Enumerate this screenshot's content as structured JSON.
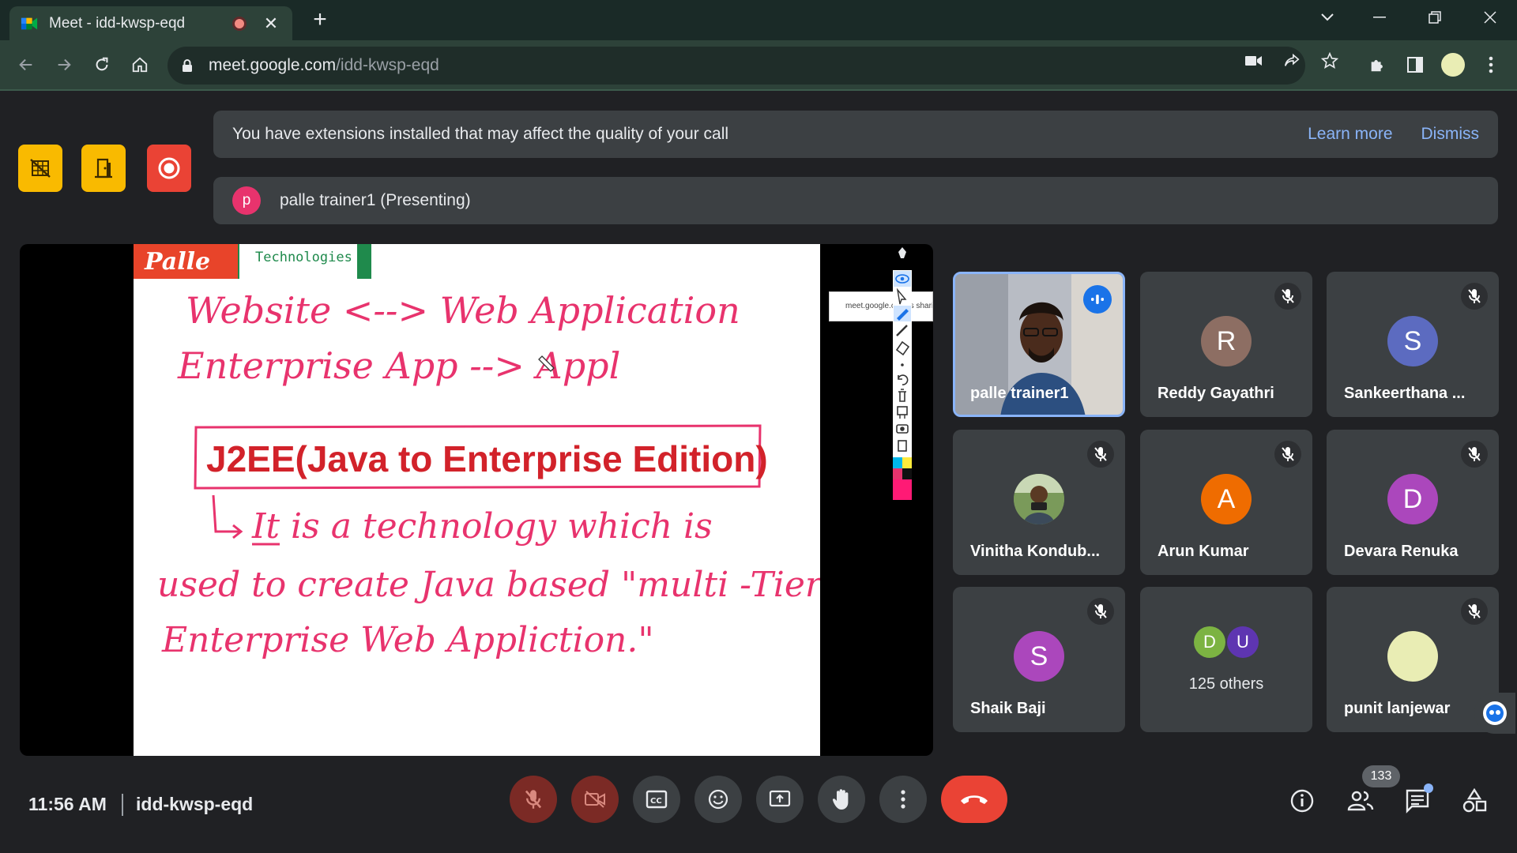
{
  "browser": {
    "tab_title": "Meet - idd-kwsp-eqd",
    "url_host": "meet.google.com",
    "url_path": "/idd-kwsp-eqd"
  },
  "banner": {
    "message": "You have extensions installed that may affect the quality of your call",
    "learn_more": "Learn more",
    "dismiss": "Dismiss"
  },
  "presenting": {
    "initial": "p",
    "text": "palle trainer1 (Presenting)"
  },
  "slide": {
    "brand": "Palle",
    "brand_sub": "Technologies",
    "line1": "Website <--> Web Application",
    "line2": "Enterprise App --> Appl",
    "heading": "J2EE(Java to Enterprise Edition)",
    "body1": "It is a technology which is",
    "body2": "used to create Java based \"multi -Tier",
    "body3": "Enterprise Web Appliction.\"",
    "share_notice": "meet.google.com is sharing"
  },
  "participants": [
    {
      "name": "palle trainer1",
      "initial": "",
      "color": "",
      "type": "video"
    },
    {
      "name": "Reddy Gayathri",
      "initial": "R",
      "color": "#8d6e63"
    },
    {
      "name": "Sankeerthana ...",
      "initial": "S",
      "color": "#5c6bc0"
    },
    {
      "name": "Vinitha Kondub...",
      "initial": "",
      "color": "",
      "type": "photo"
    },
    {
      "name": "Arun Kumar",
      "initial": "A",
      "color": "#ef6c00"
    },
    {
      "name": "Devara Renuka",
      "initial": "D",
      "color": "#ab47bc"
    },
    {
      "name": "Shaik Baji",
      "initial": "S",
      "color": "#ab47bc"
    },
    {
      "name": "125 others",
      "initial": "D",
      "initial2": "U",
      "color": "#7cb342",
      "color2": "#5e35b1"
    },
    {
      "name": "punit lanjewar",
      "initial": "",
      "color": "#e9edb4"
    }
  ],
  "bottom": {
    "time": "11:56 AM",
    "meeting_code": "idd-kwsp-eqd",
    "participant_count": "133"
  },
  "colors": {
    "accent": "#8ab4f8",
    "hangup": "#ea4335",
    "quick_yellow": "#f9ba00",
    "quick_red": "#ea4335",
    "ink": "#e8336d",
    "heading_red": "#d2222a"
  }
}
